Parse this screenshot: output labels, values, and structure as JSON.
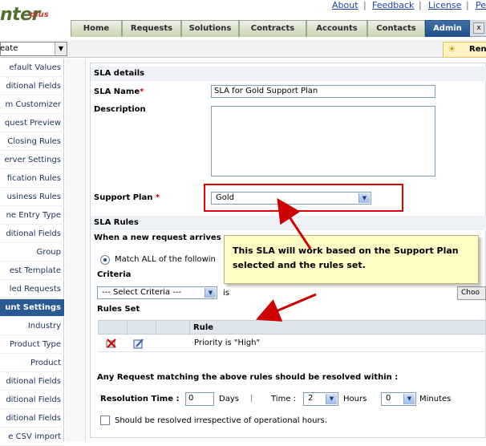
{
  "header": {
    "logo_text": "nter",
    "logo_plus": "plus",
    "top_links": [
      "About",
      "Feedback",
      "License",
      "Pe"
    ]
  },
  "tabs": [
    {
      "label": "Home",
      "active": false
    },
    {
      "label": "Requests",
      "active": false
    },
    {
      "label": "Solutions",
      "active": false
    },
    {
      "label": "Contracts",
      "active": false
    },
    {
      "label": "Accounts",
      "active": false
    },
    {
      "label": "Contacts",
      "active": false
    },
    {
      "label": "Admin",
      "active": true
    }
  ],
  "tab_extra": "x",
  "toolbar": {
    "create_value": "eate",
    "ren_label": "Ren"
  },
  "sidebar": {
    "items": [
      "efault Values",
      "ditional Fields",
      "m Customizer",
      "quest Preview",
      "Closing Rules",
      "erver Settings",
      "fication Rules",
      "usiness Rules",
      "ne Entry Type",
      "ditional Fields",
      "Group",
      "est Template",
      "led Requests",
      "unt Settings",
      "Industry",
      "Product Type",
      "Product",
      "ditional Fields",
      "ditional Fields",
      "ditional Fields",
      "e CSV import"
    ],
    "active_index": 13
  },
  "form": {
    "sla_details_heading": "SLA details",
    "sla_name_label": "SLA Name",
    "sla_name_value": "SLA for Gold Support Plan",
    "description_label": "Description",
    "support_plan_label": "Support Plan",
    "support_plan_value": "Gold",
    "required_mark": "*",
    "sla_rules_heading": "SLA Rules",
    "when_new_request": "When a new request arrives",
    "match_all_label": "Match ALL of the followin",
    "criteria_label": "Criteria",
    "criteria_select": "--- Select Criteria ---",
    "is_label": "is",
    "choose_button": "Choo",
    "rules_set_label": "Rules Set",
    "rule_col_header": "Rule",
    "rule_row_text": "Priority is \"High\"",
    "resolve_within": "Any Request matching the above rules should be resolved within :",
    "resolution_time_label": "Resolution Time :",
    "days_value": "0",
    "days_label": "Days",
    "pipe": "|",
    "time_label": "Time :",
    "hours_value": "2",
    "hours_label": "Hours",
    "minutes_value": "0",
    "minutes_label": "Minutes",
    "irrespective_label": "Should be resolved irrespective of operational hours."
  },
  "tooltip": {
    "text": "This SLA will work based on the Support Plan selected and the rules set."
  },
  "colors": {
    "accent": "#1f4f86",
    "highlight": "#e00000",
    "tooltip_bg": "#fffcc6",
    "annotation_arrow": "#cc0000"
  }
}
